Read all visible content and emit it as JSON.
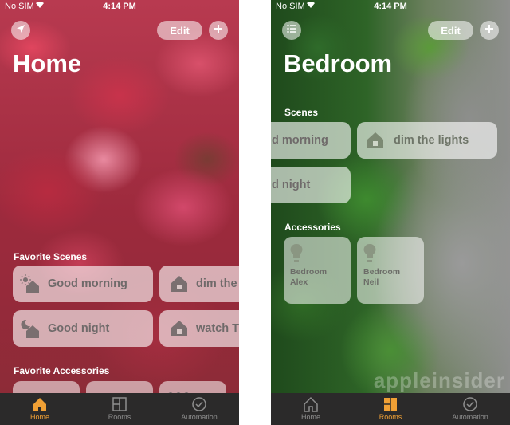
{
  "status": {
    "carrier": "No SIM",
    "time": "4:14 PM"
  },
  "home": {
    "edit_label": "Edit",
    "title": "Home",
    "favorite_scenes_label": "Favorite Scenes",
    "scenes": [
      "Good morning",
      "dim the li",
      "Good night",
      "watch TV"
    ],
    "favorite_accessories_label": "Favorite Accessories"
  },
  "bedroom": {
    "edit_label": "Edit",
    "title": "Bedroom",
    "scenes_label": "Scenes",
    "scenes": [
      "d morning",
      "dim the lights",
      "d night"
    ],
    "accessories_label": "Accessories",
    "accessories": [
      {
        "line1": "Bedroom",
        "line2": "Alex"
      },
      {
        "line1": "Bedroom",
        "line2": "Neil"
      }
    ]
  },
  "tabs": [
    "Home",
    "Rooms",
    "Automation"
  ],
  "active_tab_left": "Home",
  "active_tab_right": "Rooms",
  "colors": {
    "accent": "#f0a035",
    "tabbar": "#2b2a2a",
    "tile_text": "#6f6a6a"
  },
  "watermark": "appleinsider"
}
